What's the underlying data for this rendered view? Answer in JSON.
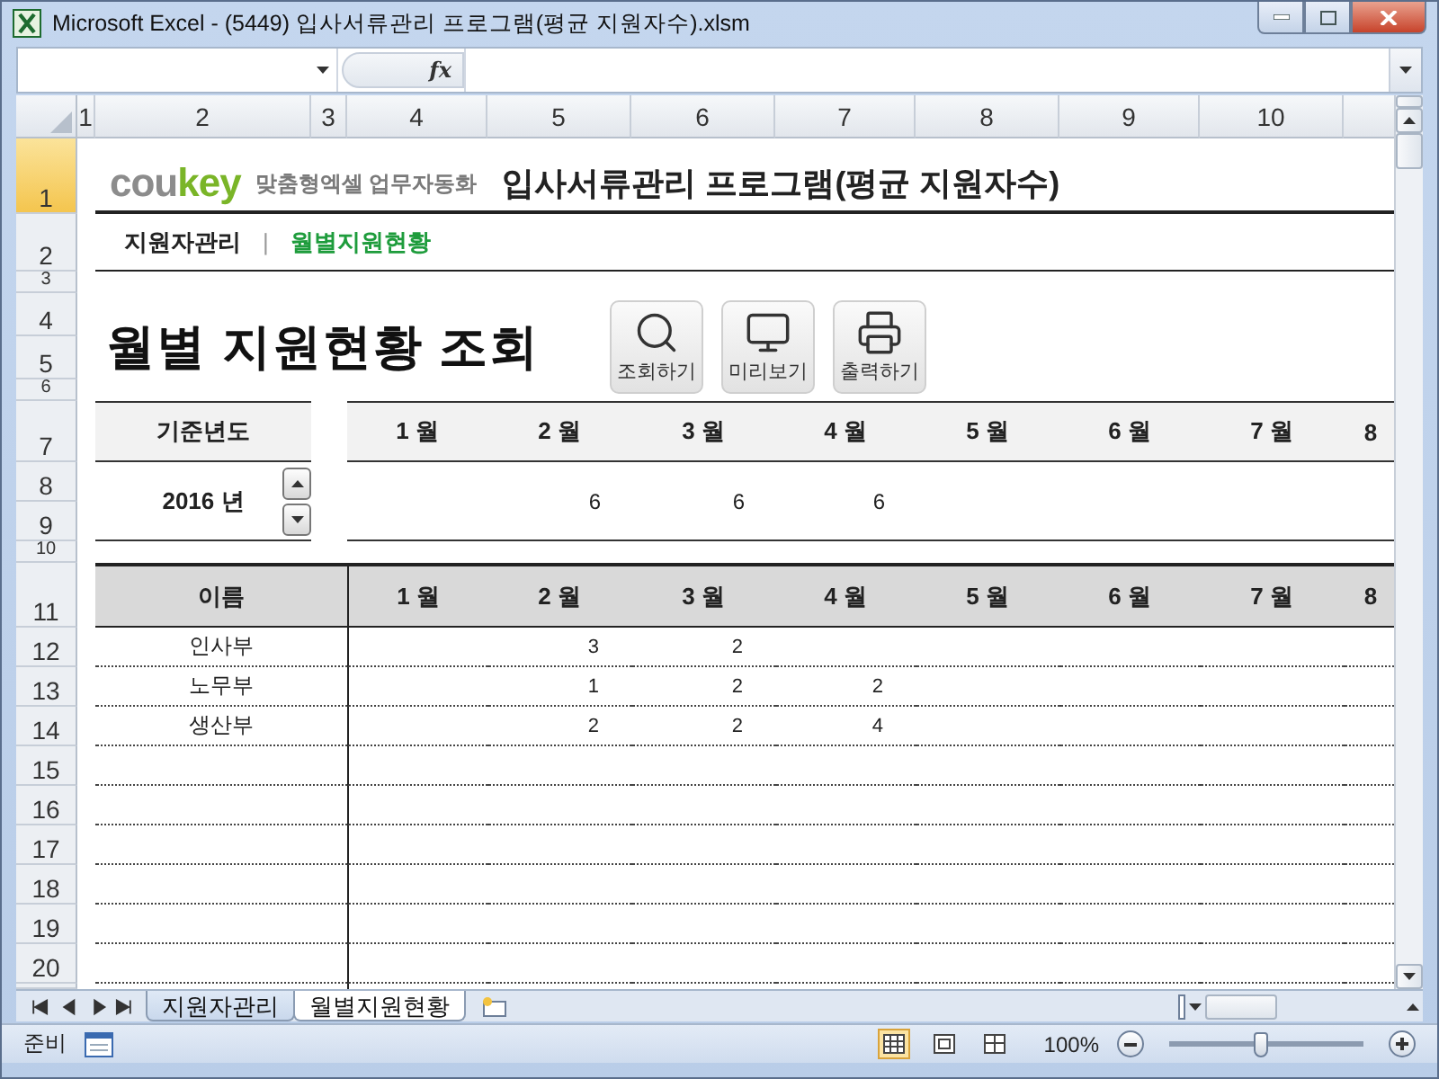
{
  "window": {
    "title": "Microsoft Excel - (5449) 입사서류관리 프로그램(평균 지원자수).xlsm"
  },
  "formula_bar": {
    "function_label": "fx"
  },
  "column_headers": [
    "1",
    "2",
    "3",
    "4",
    "5",
    "6",
    "7",
    "8",
    "9",
    "10"
  ],
  "row_headers": [
    {
      "label": "1",
      "selected": true
    },
    {
      "label": "2",
      "selected": false
    },
    {
      "label": "3",
      "selected": false
    },
    {
      "label": "4",
      "selected": false
    },
    {
      "label": "5",
      "selected": false
    },
    {
      "label": "6",
      "selected": false
    },
    {
      "label": "7",
      "selected": false
    },
    {
      "label": "8",
      "selected": false
    },
    {
      "label": "9",
      "selected": false
    },
    {
      "label": "10",
      "selected": false
    },
    {
      "label": "11",
      "selected": false
    },
    {
      "label": "12",
      "selected": false
    },
    {
      "label": "13",
      "selected": false
    },
    {
      "label": "14",
      "selected": false
    },
    {
      "label": "15",
      "selected": false
    },
    {
      "label": "16",
      "selected": false
    },
    {
      "label": "17",
      "selected": false
    },
    {
      "label": "18",
      "selected": false
    },
    {
      "label": "19",
      "selected": false
    },
    {
      "label": "20",
      "selected": false
    }
  ],
  "banner": {
    "logo": {
      "first": "cou",
      "second": "key"
    },
    "tagline": "맞춤형엑셀 업무자동화",
    "title": "입사서류관리 프로그램(평균 지원자수)"
  },
  "nav": {
    "items": [
      {
        "label": "지원자관리",
        "selected": false
      },
      {
        "label": "월별지원현황",
        "selected": true
      }
    ],
    "separator": "|"
  },
  "page_title": "월별 지원현황 조회",
  "buttons": [
    {
      "kind": "search",
      "label": "조회하기"
    },
    {
      "kind": "preview",
      "label": "미리보기"
    },
    {
      "kind": "print",
      "label": "출력하기"
    }
  ],
  "summary": {
    "label": "기준년도",
    "year": "2016 년",
    "months": [
      "1 월",
      "2 월",
      "3 월",
      "4 월",
      "5 월",
      "6 월",
      "7 월",
      "8"
    ],
    "counts": {
      "month_2": "6",
      "month_3": "6",
      "month_4": "6"
    }
  },
  "table": {
    "name_header": "이름",
    "months": [
      "1 월",
      "2 월",
      "3 월",
      "4 월",
      "5 월",
      "6 월",
      "7 월",
      "8"
    ],
    "rows": [
      {
        "name": "인사부",
        "values": {
          "month_2": "3",
          "month_3": "2"
        }
      },
      {
        "name": "노무부",
        "values": {
          "month_2": "1",
          "month_3": "2",
          "month_4": "2"
        }
      },
      {
        "name": "생산부",
        "values": {
          "month_2": "2",
          "month_3": "2",
          "month_4": "4"
        }
      }
    ]
  },
  "sheet_tabs": [
    {
      "label": "지원자관리",
      "selected": false
    },
    {
      "label": "월별지원현황",
      "selected": true
    }
  ],
  "status_bar": {
    "status": "준비",
    "zoom": "100%",
    "zoom_slider": {
      "level": 0.47
    }
  }
}
